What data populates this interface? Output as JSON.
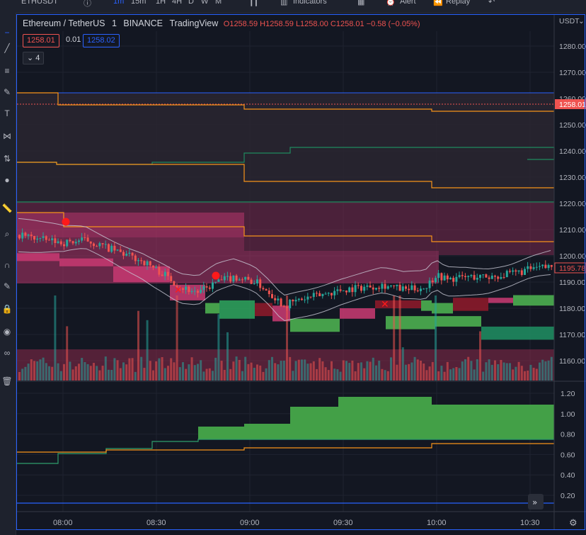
{
  "top_bar": {
    "symbol": "ETHUSDT",
    "intervals": [
      "1m",
      "15m",
      "1H",
      "4H",
      "D",
      "W",
      "M"
    ],
    "indicators_label": "Indicators",
    "alert_label": "Alert",
    "replay_label": "Replay"
  },
  "legend": {
    "pair": "Ethereum / TetherUS",
    "interval": "1",
    "exchange": "BINANCE",
    "source": "TradingView",
    "open": "O1258.59",
    "high": "H1258.59",
    "low": "L1258.00",
    "close": "C1258.01",
    "change": "−0.58 (−0.05%)",
    "bid": "1258.01",
    "spread": "0.01",
    "ask": "1258.02",
    "collapsed_count": "4"
  },
  "colors": {
    "background": "#131722",
    "accent": "#2962ff",
    "down": "#ef5350",
    "up": "#26a69a",
    "pink": "#d63f7f",
    "green": "#4caf50",
    "orange": "#ff9800"
  },
  "price_axis": {
    "currency": "USDT",
    "ticks": [
      "1280.00",
      "1270.00",
      "1260.00",
      "1250.00",
      "1240.00",
      "1230.00",
      "1220.00",
      "1210.00",
      "1200.00",
      "1190.00",
      "1180.00",
      "1170.00",
      "1160.00"
    ],
    "last_price_tag": "1258.01",
    "secondary_tag": "1195.78"
  },
  "osc_axis": {
    "ticks": [
      "1.20",
      "1.00",
      "0.80",
      "0.60",
      "0.40",
      "0.20"
    ]
  },
  "time_axis": {
    "ticks": [
      "08:00",
      "08:30",
      "09:00",
      "09:30",
      "10:00",
      "10:30"
    ]
  },
  "chart_data": {
    "type": "candlestick",
    "y_range": [
      1152,
      1287
    ],
    "x_range": [
      "07:45",
      "10:45"
    ],
    "last_price": 1258.01,
    "secondary_price": 1195.78,
    "oscillator_range": [
      0,
      1.3
    ],
    "grid": true
  }
}
